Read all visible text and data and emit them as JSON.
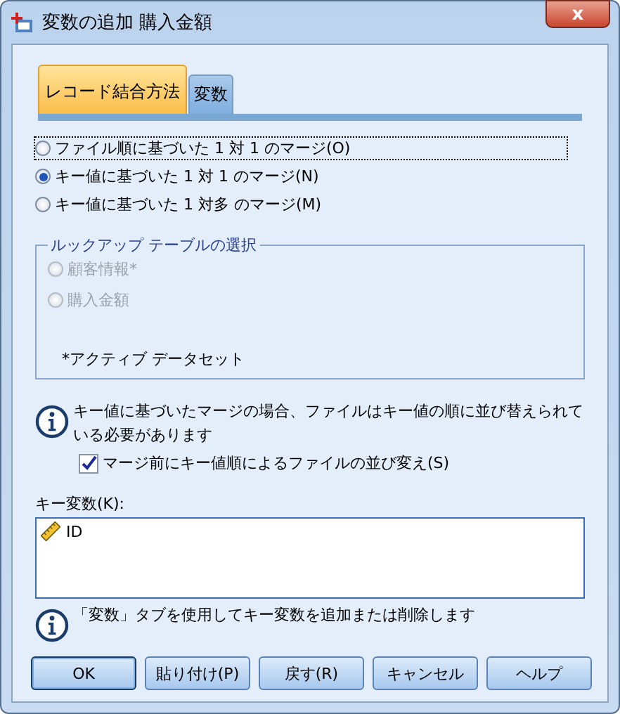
{
  "window": {
    "title": "変数の追加 購入金額",
    "close": "x"
  },
  "tabs": [
    {
      "label": "レコード結合方法",
      "selected": true
    },
    {
      "label": "変数",
      "selected": false
    }
  ],
  "merge_methods": [
    {
      "label": "ファイル順に基づいた 1 対 1 のマージ(O)",
      "selected": false,
      "focused": true
    },
    {
      "label": "キー値に基づいた 1 対 1 のマージ(N)",
      "selected": true,
      "focused": false
    },
    {
      "label": "キー値に基づいた 1 対多 のマージ(M)",
      "selected": false,
      "focused": false
    }
  ],
  "lookup_group": {
    "title": "ルックアップ テーブルの選択",
    "options": [
      {
        "label": "顧客情報*",
        "selected": false,
        "disabled": true
      },
      {
        "label": "購入金額",
        "selected": false,
        "disabled": true
      }
    ],
    "note": "*アクティブ データセット"
  },
  "info_message": "キー値に基づいたマージの場合、ファイルはキー値の順に並び替えられている必要があります",
  "sort_checkbox": {
    "label": "マージ前にキー値順によるファイルの並び変え(S)",
    "checked": true
  },
  "key_variables": {
    "label": "キー変数(K):",
    "items": [
      "ID"
    ]
  },
  "hint_message": "「変数」タブを使用してキー変数を追加または削除します",
  "buttons": [
    {
      "label": "OK",
      "default": true
    },
    {
      "label": "貼り付け(P)",
      "default": false
    },
    {
      "label": "戻す(R)",
      "default": false
    },
    {
      "label": "キャンセル",
      "default": false
    },
    {
      "label": "ヘルプ",
      "default": false
    }
  ]
}
